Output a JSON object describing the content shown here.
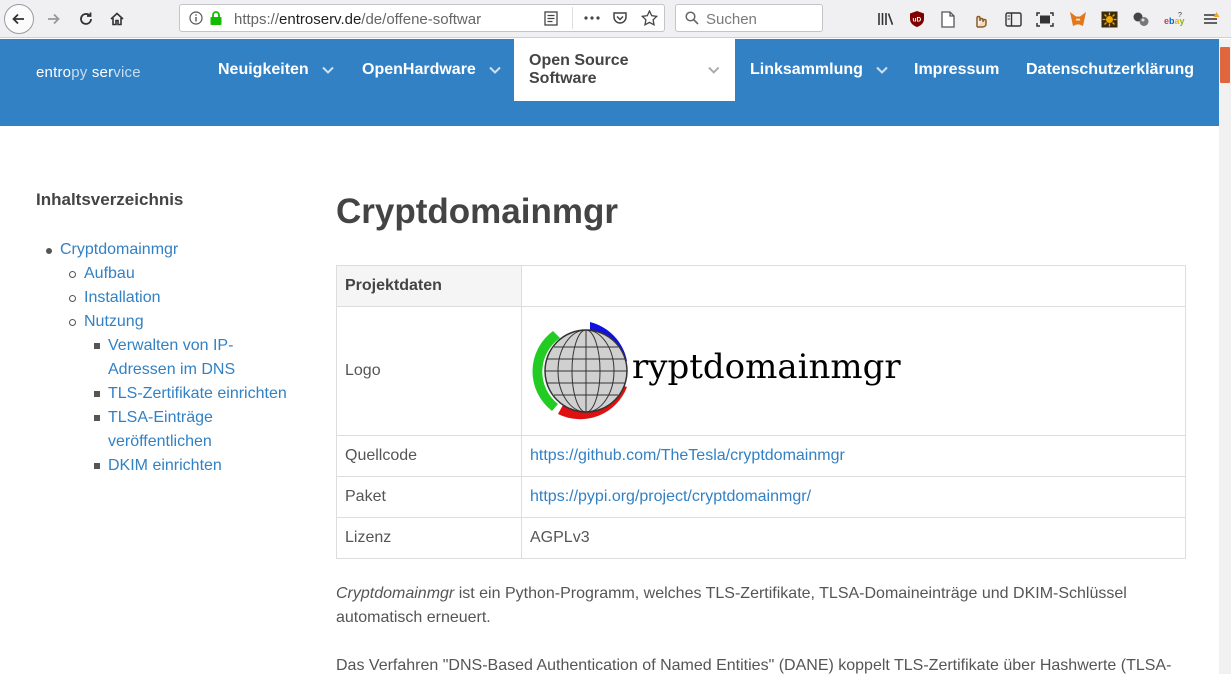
{
  "browser": {
    "url_prefix": "https://",
    "url_host": "entroserv.de",
    "url_path": "/de/offene-softwar",
    "search_placeholder": "Suchen"
  },
  "site": {
    "brand_a": "entro",
    "brand_b": "py",
    "brand_c": " ser",
    "brand_d": "vice",
    "nav": [
      {
        "label": "Neuigkeiten"
      },
      {
        "label": "OpenHardware"
      },
      {
        "label": "Open Source Software"
      },
      {
        "label": "Linksammlung"
      },
      {
        "label": "Impressum"
      },
      {
        "label": "Datenschutzerklärung"
      }
    ]
  },
  "toc": {
    "title": "Inhaltsverzeichnis",
    "items": [
      {
        "label": "Cryptdomainmgr"
      },
      {
        "label": "Aufbau"
      },
      {
        "label": "Installation"
      },
      {
        "label": "Nutzung"
      },
      {
        "label_l1": "Verwalten von IP-",
        "label_l2": "Adressen im DNS"
      },
      {
        "label": "TLS-Zertifikate einrichten"
      },
      {
        "label_l1": "TLSA-Einträge",
        "label_l2": "veröffentlichen"
      },
      {
        "label": "DKIM einrichten"
      }
    ]
  },
  "main": {
    "title": "Cryptdomainmgr",
    "table": {
      "header": "Projektdaten",
      "logo_label": "Logo",
      "logo_text": "ryptdomainmgr",
      "source_label": "Quellcode",
      "source_value": "https://github.com/TheTesla/cryptdomainmgr",
      "package_label": "Paket",
      "package_value": "https://pypi.org/project/cryptdomainmgr/",
      "license_label": "Lizenz",
      "license_value": "AGPLv3"
    },
    "para1_em": "Cryptdomainmgr",
    "para1_rest": " ist ein Python-Programm, welches TLS-Zertifikate, TLSA-Domaineinträge und DKIM-Schlüssel automatisch erneuert.",
    "para2": "Das Verfahren \"DNS-Based Authentication of Named Entities\" (DANE) koppelt TLS-Zertifikate über Hashwerte (TLSA-"
  },
  "colors": {
    "header_bg": "#3281c4",
    "link": "#3281c4",
    "text": "#555555",
    "scroll_thumb": "#e2663d"
  }
}
